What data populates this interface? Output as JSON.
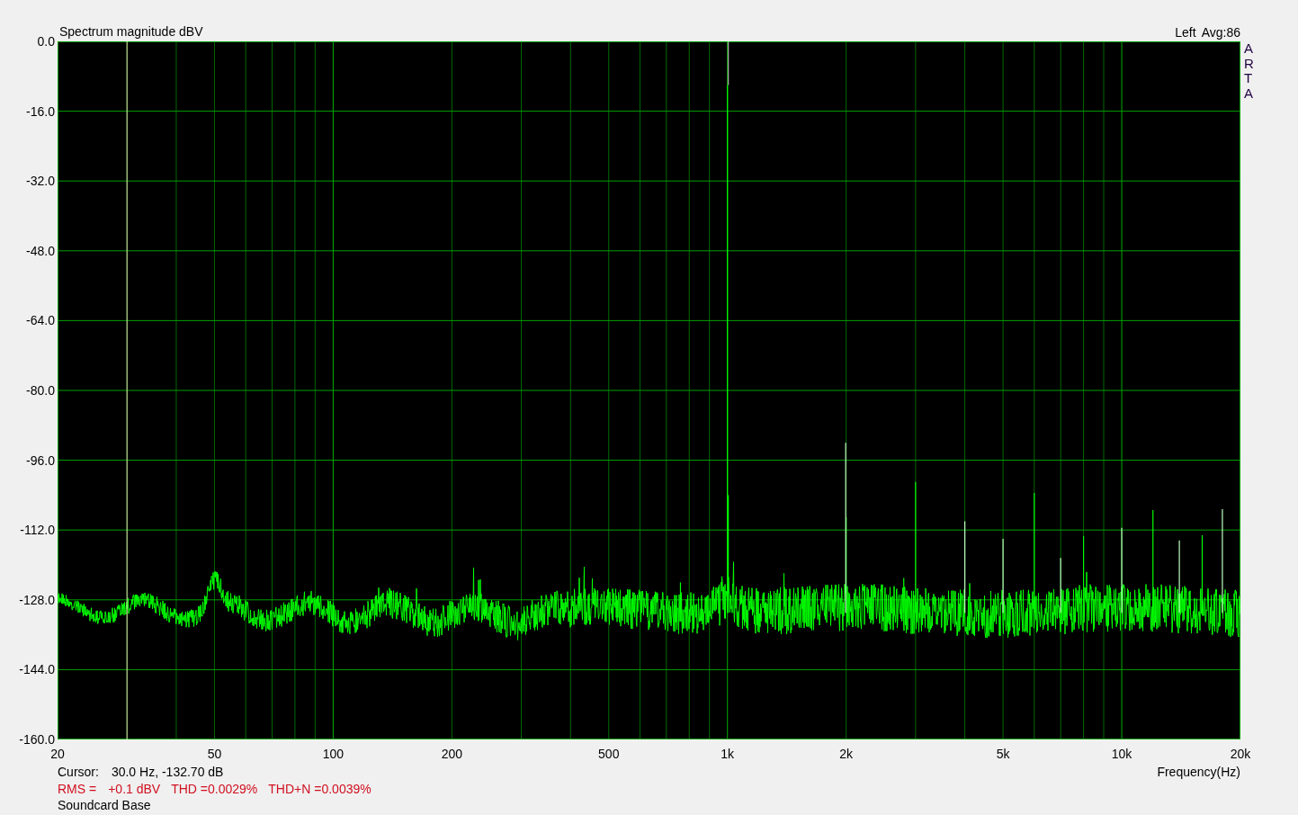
{
  "title": "Spectrum magnitude dBV",
  "channel": "Left",
  "average": "Avg:86",
  "brand": "ARTA",
  "y_ticks": [
    "0.0",
    "-16.0",
    "-32.0",
    "-48.0",
    "-64.0",
    "-80.0",
    "-96.0",
    "-112.0",
    "-128.0",
    "-144.0",
    "-160.0"
  ],
  "x_ticks": [
    "20",
    "50",
    "100",
    "200",
    "500",
    "1k",
    "2k",
    "5k",
    "10k",
    "20k"
  ],
  "x_axis_label": "Frequency(Hz)",
  "cursor": {
    "label": "Cursor:",
    "value": "30.0 Hz, -132.70 dB"
  },
  "stats": {
    "rms_label": "RMS =",
    "rms": "+0.1 dBV",
    "thd": "THD =0.0029%",
    "thdn": "THD+N =0.0039%"
  },
  "caption": "Soundcard Base"
}
